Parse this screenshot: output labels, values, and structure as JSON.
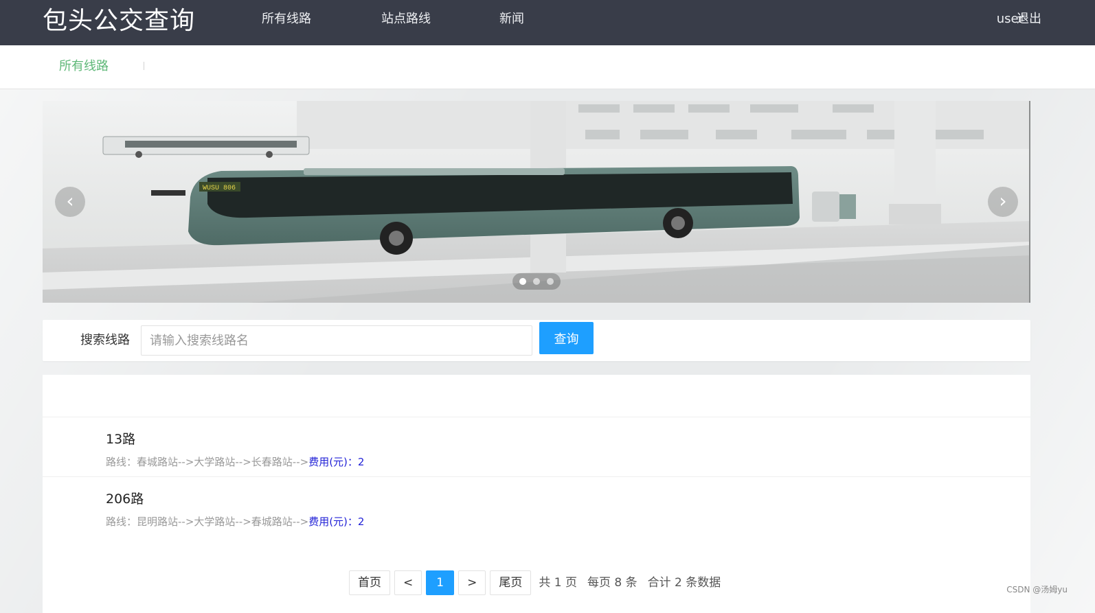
{
  "header": {
    "logo": "包头公交查询",
    "nav": [
      "所有线路",
      "站点路线",
      "新闻"
    ],
    "user": "user",
    "logout": "退出"
  },
  "subnav": {
    "active": "所有线路"
  },
  "carousel": {
    "dots": 3,
    "active_dot": 1,
    "bus_sign": "WUSU 806"
  },
  "search": {
    "label": "搜索线路",
    "placeholder": "请输入搜索线路名",
    "value": "",
    "button": "查询"
  },
  "routes": [
    {
      "name": "13路",
      "desc": "路线：春城路站-->大学路站-->长春路站-->",
      "fee": "费用(元)：2"
    },
    {
      "name": "206路",
      "desc": "路线：昆明路站-->大学路站-->春城路站-->",
      "fee": "费用(元)：2"
    }
  ],
  "pager": {
    "first": "首页",
    "prev": "<",
    "current": "1",
    "next": ">",
    "last": "尾页",
    "total_pages": "共 1 页",
    "per_page": "每页 8 条",
    "total": "合计 2 条数据"
  },
  "watermark": "CSDN @汤姆yu",
  "colors": {
    "header_bg": "#393d49",
    "accent": "#1e9fff",
    "active_green": "#5fb878",
    "fee": "#2121d6"
  }
}
